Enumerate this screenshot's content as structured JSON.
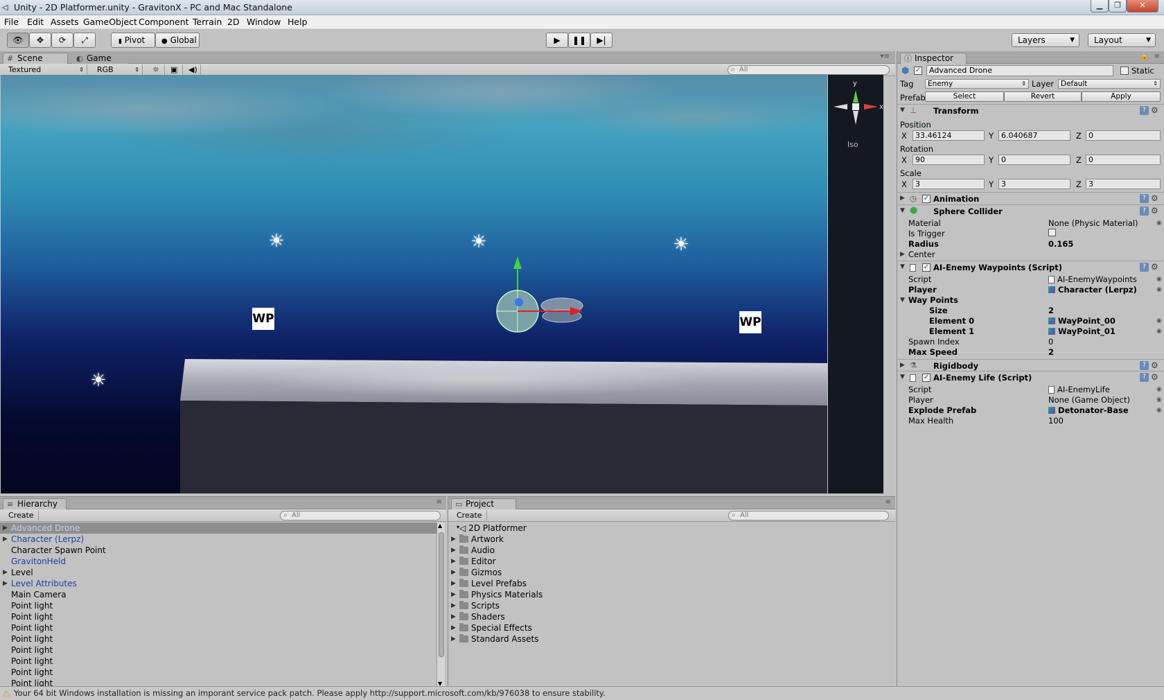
{
  "window": {
    "title": "Unity - 2D Platformer.unity - GravitonX - PC and Mac Standalone",
    "app_icon": "unity-icon",
    "controls": [
      "minimize-icon",
      "maximize-icon",
      "close-icon"
    ]
  },
  "menu": [
    "File",
    "Edit",
    "Assets",
    "GameObject",
    "Component",
    "Terrain",
    "2D",
    "Window",
    "Help"
  ],
  "toolbar": {
    "pivot_label": "Pivot",
    "global_label": "Global",
    "layers_label": "Layers",
    "layout_label": "Layout"
  },
  "scene_panel": {
    "tab_scene": "Scene",
    "tab_game": "Game",
    "render_mode": "Textured",
    "color_mode": "RGB",
    "search_placeholder": "All",
    "gizmo_y": "y",
    "gizmo_x": "x",
    "projection": "Iso",
    "waypoint_label": "WP"
  },
  "inspector": {
    "tab": "Inspector",
    "object_name": "Advanced Drone",
    "static_label": "Static",
    "tag_label": "Tag",
    "tag_value": "Enemy",
    "layer_label": "Layer",
    "layer_value": "Default",
    "prefab_label": "Prefab",
    "prefab_select": "Select",
    "prefab_revert": "Revert",
    "prefab_apply": "Apply",
    "transform": {
      "title": "Transform",
      "position_label": "Position",
      "rotation_label": "Rotation",
      "scale_label": "Scale",
      "x": "X",
      "y": "Y",
      "z": "Z",
      "position": [
        "33.46124",
        "6.040687",
        "0"
      ],
      "rotation": [
        "90",
        "0",
        "0"
      ],
      "scale": [
        "3",
        "3",
        "3"
      ]
    },
    "animation": {
      "title": "Animation"
    },
    "sphere_collider": {
      "title": "Sphere Collider",
      "material_label": "Material",
      "material_value": "None (Physic Material)",
      "trigger_label": "Is Trigger",
      "radius_label": "Radius",
      "radius_value": "0.165",
      "center_label": "Center"
    },
    "waypoints_script": {
      "title": "AI-Enemy Waypoints (Script)",
      "script_label": "Script",
      "script_value": "AI-EnemyWaypoints",
      "player_label": "Player",
      "player_value": "Character (Lerpz)",
      "way_points_label": "Way Points",
      "size_label": "Size",
      "size_value": "2",
      "element0_label": "Element 0",
      "element0_value": "WayPoint_00",
      "element1_label": "Element 1",
      "element1_value": "WayPoint_01",
      "spawn_label": "Spawn Index",
      "spawn_value": "0",
      "maxspeed_label": "Max Speed",
      "maxspeed_value": "2"
    },
    "rigidbody": {
      "title": "Rigidbody"
    },
    "life_script": {
      "title": "AI-Enemy Life (Script)",
      "script_label": "Script",
      "script_value": "AI-EnemyLife",
      "player_label": "Player",
      "player_value": "None (Game Object)",
      "explode_label": "Explode Prefab",
      "explode_value": "Detonator-Base",
      "maxhealth_label": "Max Health",
      "maxhealth_value": "100"
    }
  },
  "hierarchy": {
    "tab": "Hierarchy",
    "create_label": "Create",
    "search_placeholder": "All",
    "items": [
      {
        "label": "Advanced Drone"
      },
      {
        "label": "Character (Lerpz)"
      },
      {
        "label": "Character Spawn Point"
      },
      {
        "label": "GravitonHeld"
      },
      {
        "label": "Level"
      },
      {
        "label": "Level Attributes"
      },
      {
        "label": "Main Camera"
      },
      {
        "label": "Point light"
      },
      {
        "label": "Point light"
      },
      {
        "label": "Point light"
      },
      {
        "label": "Point light"
      },
      {
        "label": "Point light"
      },
      {
        "label": "Point light"
      },
      {
        "label": "Point light"
      },
      {
        "label": "Point light"
      }
    ]
  },
  "project": {
    "tab": "Project",
    "create_label": "Create",
    "search_placeholder": "All",
    "items": [
      {
        "label": "2D Platformer"
      },
      {
        "label": "Artwork"
      },
      {
        "label": "Audio"
      },
      {
        "label": "Editor"
      },
      {
        "label": "Gizmos"
      },
      {
        "label": "Level Prefabs"
      },
      {
        "label": "Physics Materials"
      },
      {
        "label": "Scripts"
      },
      {
        "label": "Shaders"
      },
      {
        "label": "Special Effects"
      },
      {
        "label": "Standard Assets"
      }
    ]
  },
  "status": {
    "message": "Your 64 bit Windows installation is missing an imporant service pack patch. Please apply http://support.microsoft.com/kb/976038 to ensure stability."
  }
}
